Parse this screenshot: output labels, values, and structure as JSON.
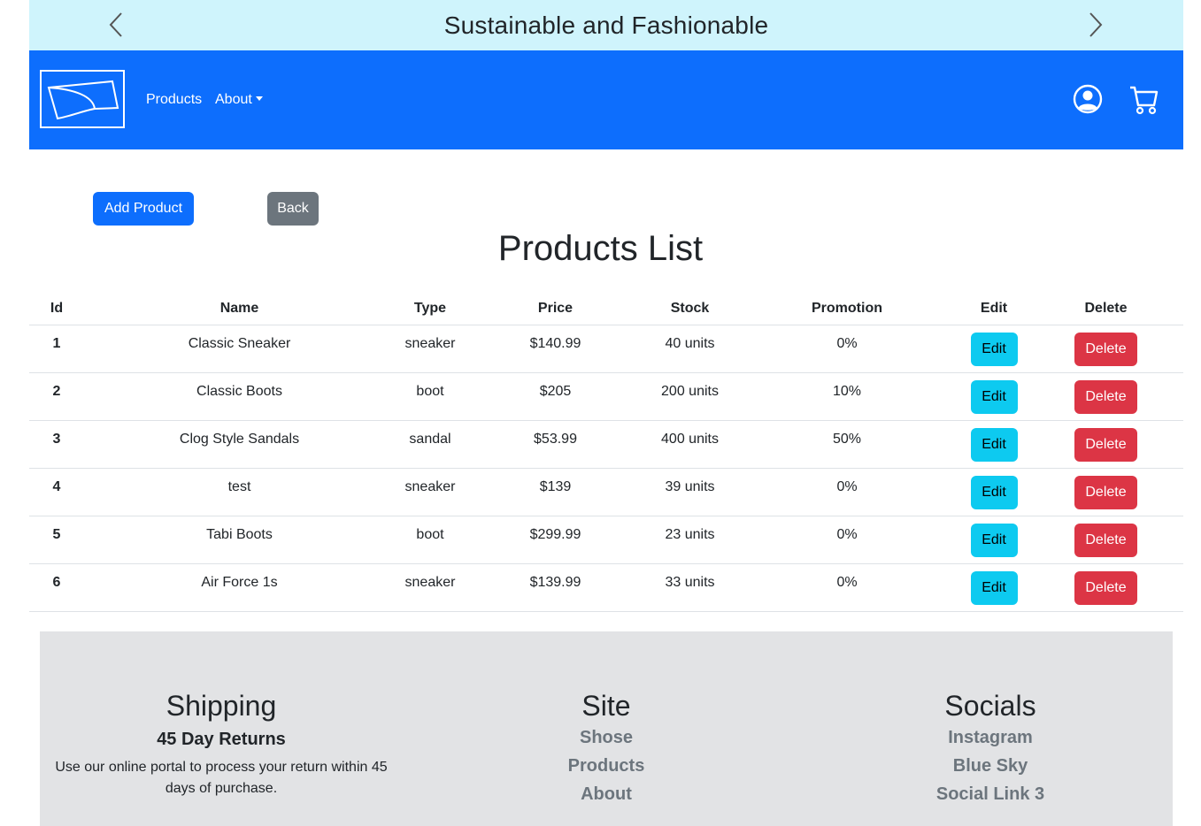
{
  "banner": {
    "text": "Sustainable and Fashionable",
    "prev_icon": "chevron-left-icon",
    "next_icon": "chevron-right-icon",
    "background": "#cff4fc"
  },
  "navbar": {
    "background": "#0d6efd",
    "logo_icon": "shose-logo",
    "links": {
      "products": "Products",
      "about": "About"
    },
    "user_icon": "person-circle-icon",
    "cart_icon": "cart-icon"
  },
  "actions": {
    "add_product": "Add Product",
    "back": "Back"
  },
  "page_title": "Products List",
  "table": {
    "headers": [
      "Id",
      "Name",
      "Type",
      "Price",
      "Stock",
      "Promotion",
      "Edit",
      "Delete"
    ],
    "rows": [
      {
        "id": "1",
        "name": "Classic Sneaker",
        "type": "sneaker",
        "price": "$140.99",
        "stock": "40 units",
        "promotion": "0%",
        "edit": "Edit",
        "delete": "Delete"
      },
      {
        "id": "2",
        "name": "Classic Boots",
        "type": "boot",
        "price": "$205",
        "stock": "200 units",
        "promotion": "10%",
        "edit": "Edit",
        "delete": "Delete"
      },
      {
        "id": "3",
        "name": "Clog Style Sandals",
        "type": "sandal",
        "price": "$53.99",
        "stock": "400 units",
        "promotion": "50%",
        "edit": "Edit",
        "delete": "Delete"
      },
      {
        "id": "4",
        "name": "test",
        "type": "sneaker",
        "price": "$139",
        "stock": "39 units",
        "promotion": "0%",
        "edit": "Edit",
        "delete": "Delete"
      },
      {
        "id": "5",
        "name": "Tabi Boots",
        "type": "boot",
        "price": "$299.99",
        "stock": "23 units",
        "promotion": "0%",
        "edit": "Edit",
        "delete": "Delete"
      },
      {
        "id": "6",
        "name": "Air Force 1s",
        "type": "sneaker",
        "price": "$139.99",
        "stock": "33 units",
        "promotion": "0%",
        "edit": "Edit",
        "delete": "Delete"
      }
    ]
  },
  "footer": {
    "shipping": {
      "heading": "Shipping",
      "subheading": "45 Day Returns",
      "text": "Use our online portal to process your return within 45 days of purchase."
    },
    "site": {
      "heading": "Site",
      "links": [
        "Shose",
        "Products",
        "About"
      ]
    },
    "socials": {
      "heading": "Socials",
      "links": [
        "Instagram",
        "Blue Sky",
        "Social Link 3"
      ]
    }
  },
  "colors": {
    "primary": "#0d6efd",
    "secondary": "#6c757d",
    "info": "#0dcaf0",
    "danger": "#dc3545",
    "footer_bg": "#e2e3e5"
  }
}
